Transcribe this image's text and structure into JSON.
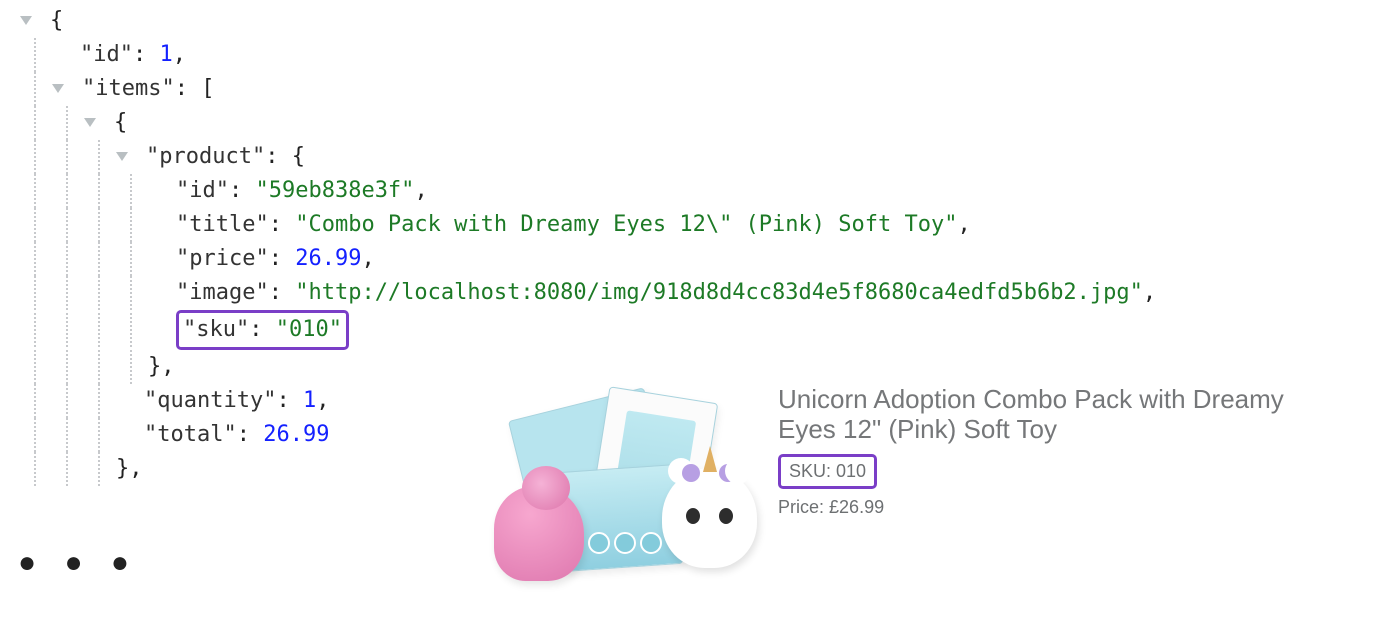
{
  "json_view": {
    "root_open": "{",
    "id_key": "\"id\"",
    "id_val": "1",
    "items_key": "\"items\"",
    "item_open": "{",
    "product_key": "\"product\"",
    "product_open": "{",
    "product": {
      "id_key": "\"id\"",
      "id_val": "\"59eb838e3f\"",
      "title_key": "\"title\"",
      "title_val": "\"Combo Pack with Dreamy Eyes 12\\\" (Pink) Soft Toy\"",
      "price_key": "\"price\"",
      "price_val": "26.99",
      "image_key": "\"image\"",
      "image_val": "\"http://localhost:8080/img/918d8d4cc83d4e5f8680ca4edfd5b6b2.jpg\"",
      "sku_key": "\"sku\"",
      "sku_val_quoted": "\"010\""
    },
    "product_close": "},",
    "quantity_key": "\"quantity\"",
    "quantity_val": "1",
    "total_key": "\"total\"",
    "total_val": "26.99",
    "item_close": "},"
  },
  "ellipsis": "● ● ●",
  "card": {
    "title": "Unicorn Adoption Combo Pack with Dreamy Eyes 12\" (Pink) Soft Toy",
    "sku_label": "SKU:",
    "sku_value": "010",
    "price_label": "Price:",
    "price_value": "£26.99"
  }
}
